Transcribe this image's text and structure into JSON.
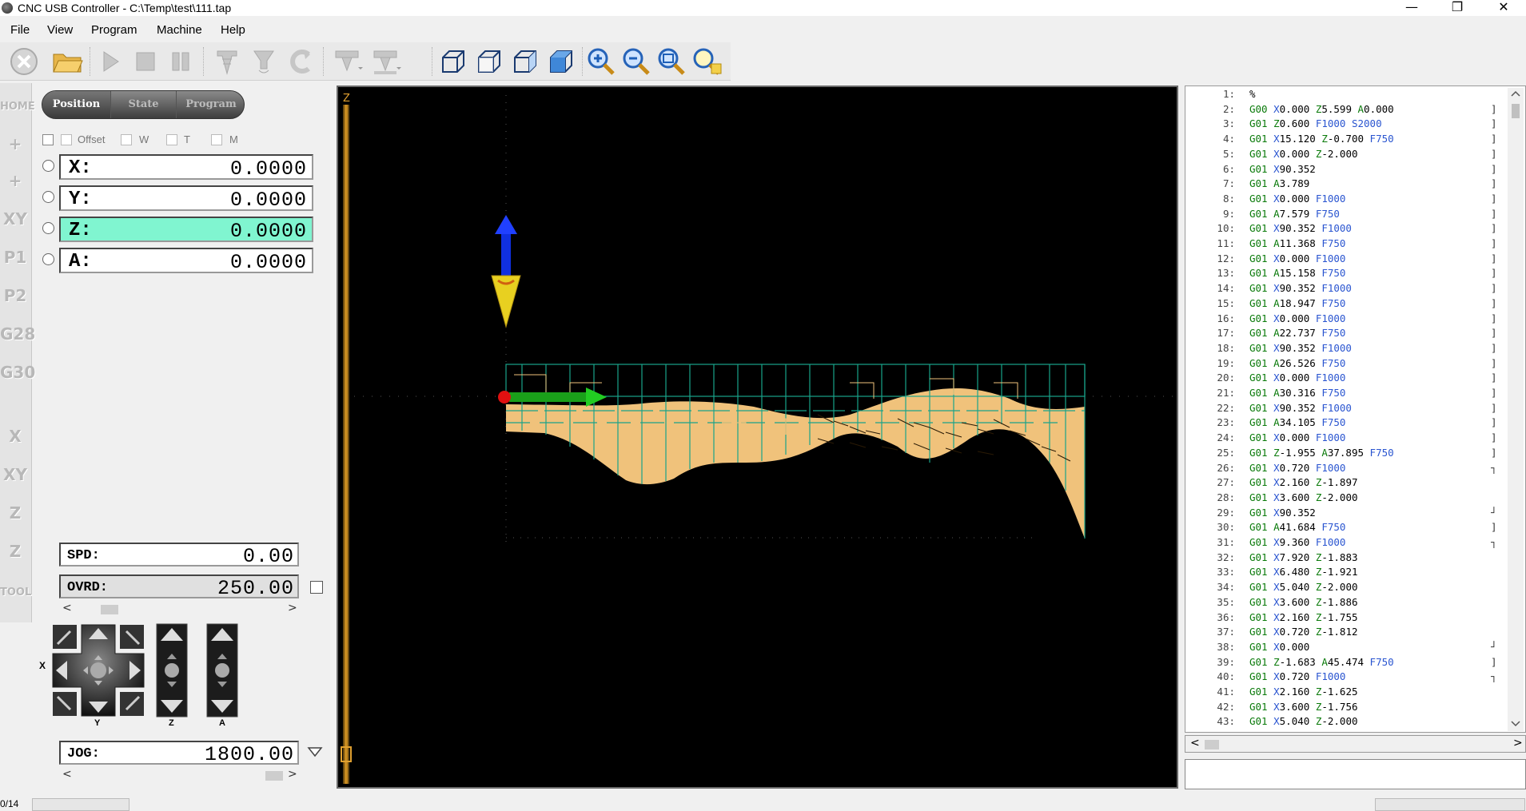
{
  "window": {
    "title": "CNC USB Controller - C:\\Temp\\test\\111.tap",
    "minimize_glyph": "—",
    "restore_glyph": "❐",
    "close_glyph": "✕"
  },
  "menu": [
    "File",
    "View",
    "Program",
    "Machine",
    "Help"
  ],
  "vtoolbar": [
    "HOME",
    "+",
    "+",
    "XY",
    "P1",
    "P2",
    "G28",
    "G30",
    "X",
    "XY",
    "Z",
    "Z",
    "TOOL"
  ],
  "panel": {
    "tabs": [
      "Position",
      "State",
      "Program"
    ],
    "checkbox_labels": [
      "Offset",
      "W",
      "T",
      "M"
    ],
    "axes": [
      {
        "label": "X:",
        "value": "0.0000"
      },
      {
        "label": "Y:",
        "value": "0.0000"
      },
      {
        "label": "Z:",
        "value": "0.0000"
      },
      {
        "label": "A:",
        "value": "0.0000"
      }
    ],
    "spd": {
      "label": "SPD:",
      "value": "0.00"
    },
    "ovrd": {
      "label": "OVRD:",
      "value": "250.00"
    },
    "jog": {
      "label": "JOG:",
      "value": "1800.00"
    },
    "jog_axis_labels": {
      "x": "X",
      "y": "Y",
      "z": "Z",
      "a": "A"
    },
    "scroll_left": "<",
    "scroll_right": ">"
  },
  "viewport": {
    "axis_label": "Z"
  },
  "code_lines": [
    {
      "n": "1:",
      "tokens": [
        [
          "%",
          "p"
        ]
      ],
      "br": ""
    },
    {
      "n": "2:",
      "tokens": [
        [
          "G00",
          "g"
        ],
        [
          "X",
          "x"
        ],
        [
          "0.000",
          "p"
        ],
        [
          "Z",
          "z"
        ],
        [
          "5.599",
          "p"
        ],
        [
          "A",
          "a"
        ],
        [
          "0.000",
          "p"
        ]
      ],
      "br": "]"
    },
    {
      "n": "3:",
      "tokens": [
        [
          "G01",
          "g"
        ],
        [
          "Z",
          "z"
        ],
        [
          "0.600",
          "p"
        ],
        [
          "F1000",
          "f"
        ],
        [
          "S2000",
          "s"
        ]
      ],
      "br": "]"
    },
    {
      "n": "4:",
      "tokens": [
        [
          "G01",
          "g"
        ],
        [
          "X",
          "x"
        ],
        [
          "15.120",
          "p"
        ],
        [
          "Z",
          "z"
        ],
        [
          "-0.700",
          "p"
        ],
        [
          "F750",
          "f"
        ]
      ],
      "br": "]"
    },
    {
      "n": "5:",
      "tokens": [
        [
          "G01",
          "g"
        ],
        [
          "X",
          "x"
        ],
        [
          "0.000",
          "p"
        ],
        [
          "Z",
          "z"
        ],
        [
          "-2.000",
          "p"
        ]
      ],
      "br": "]"
    },
    {
      "n": "6:",
      "tokens": [
        [
          "G01",
          "g"
        ],
        [
          "X",
          "x"
        ],
        [
          "90.352",
          "p"
        ]
      ],
      "br": "]"
    },
    {
      "n": "7:",
      "tokens": [
        [
          "G01",
          "g"
        ],
        [
          "A",
          "a"
        ],
        [
          "3.789",
          "p"
        ]
      ],
      "br": "]"
    },
    {
      "n": "8:",
      "tokens": [
        [
          "G01",
          "g"
        ],
        [
          "X",
          "x"
        ],
        [
          "0.000",
          "p"
        ],
        [
          "F1000",
          "f"
        ]
      ],
      "br": "]"
    },
    {
      "n": "9:",
      "tokens": [
        [
          "G01",
          "g"
        ],
        [
          "A",
          "a"
        ],
        [
          "7.579",
          "p"
        ],
        [
          "F750",
          "f"
        ]
      ],
      "br": "]"
    },
    {
      "n": "10:",
      "tokens": [
        [
          "G01",
          "g"
        ],
        [
          "X",
          "x"
        ],
        [
          "90.352",
          "p"
        ],
        [
          "F1000",
          "f"
        ]
      ],
      "br": "]"
    },
    {
      "n": "11:",
      "tokens": [
        [
          "G01",
          "g"
        ],
        [
          "A",
          "a"
        ],
        [
          "11.368",
          "p"
        ],
        [
          "F750",
          "f"
        ]
      ],
      "br": "]"
    },
    {
      "n": "12:",
      "tokens": [
        [
          "G01",
          "g"
        ],
        [
          "X",
          "x"
        ],
        [
          "0.000",
          "p"
        ],
        [
          "F1000",
          "f"
        ]
      ],
      "br": "]"
    },
    {
      "n": "13:",
      "tokens": [
        [
          "G01",
          "g"
        ],
        [
          "A",
          "a"
        ],
        [
          "15.158",
          "p"
        ],
        [
          "F750",
          "f"
        ]
      ],
      "br": "]"
    },
    {
      "n": "14:",
      "tokens": [
        [
          "G01",
          "g"
        ],
        [
          "X",
          "x"
        ],
        [
          "90.352",
          "p"
        ],
        [
          "F1000",
          "f"
        ]
      ],
      "br": "]"
    },
    {
      "n": "15:",
      "tokens": [
        [
          "G01",
          "g"
        ],
        [
          "A",
          "a"
        ],
        [
          "18.947",
          "p"
        ],
        [
          "F750",
          "f"
        ]
      ],
      "br": "]"
    },
    {
      "n": "16:",
      "tokens": [
        [
          "G01",
          "g"
        ],
        [
          "X",
          "x"
        ],
        [
          "0.000",
          "p"
        ],
        [
          "F1000",
          "f"
        ]
      ],
      "br": "]"
    },
    {
      "n": "17:",
      "tokens": [
        [
          "G01",
          "g"
        ],
        [
          "A",
          "a"
        ],
        [
          "22.737",
          "p"
        ],
        [
          "F750",
          "f"
        ]
      ],
      "br": "]"
    },
    {
      "n": "18:",
      "tokens": [
        [
          "G01",
          "g"
        ],
        [
          "X",
          "x"
        ],
        [
          "90.352",
          "p"
        ],
        [
          "F1000",
          "f"
        ]
      ],
      "br": "]"
    },
    {
      "n": "19:",
      "tokens": [
        [
          "G01",
          "g"
        ],
        [
          "A",
          "a"
        ],
        [
          "26.526",
          "p"
        ],
        [
          "F750",
          "f"
        ]
      ],
      "br": "]"
    },
    {
      "n": "20:",
      "tokens": [
        [
          "G01",
          "g"
        ],
        [
          "X",
          "x"
        ],
        [
          "0.000",
          "p"
        ],
        [
          "F1000",
          "f"
        ]
      ],
      "br": "]"
    },
    {
      "n": "21:",
      "tokens": [
        [
          "G01",
          "g"
        ],
        [
          "A",
          "a"
        ],
        [
          "30.316",
          "p"
        ],
        [
          "F750",
          "f"
        ]
      ],
      "br": "]"
    },
    {
      "n": "22:",
      "tokens": [
        [
          "G01",
          "g"
        ],
        [
          "X",
          "x"
        ],
        [
          "90.352",
          "p"
        ],
        [
          "F1000",
          "f"
        ]
      ],
      "br": "]"
    },
    {
      "n": "23:",
      "tokens": [
        [
          "G01",
          "g"
        ],
        [
          "A",
          "a"
        ],
        [
          "34.105",
          "p"
        ],
        [
          "F750",
          "f"
        ]
      ],
      "br": "]"
    },
    {
      "n": "24:",
      "tokens": [
        [
          "G01",
          "g"
        ],
        [
          "X",
          "x"
        ],
        [
          "0.000",
          "p"
        ],
        [
          "F1000",
          "f"
        ]
      ],
      "br": "]"
    },
    {
      "n": "25:",
      "tokens": [
        [
          "G01",
          "g"
        ],
        [
          "Z",
          "z"
        ],
        [
          "-1.955",
          "p"
        ],
        [
          "A",
          "a"
        ],
        [
          "37.895",
          "p"
        ],
        [
          "F750",
          "f"
        ]
      ],
      "br": "]"
    },
    {
      "n": "26:",
      "tokens": [
        [
          "G01",
          "g"
        ],
        [
          "X",
          "x"
        ],
        [
          "0.720",
          "p"
        ],
        [
          "F1000",
          "f"
        ]
      ],
      "br": "┐"
    },
    {
      "n": "27:",
      "tokens": [
        [
          "G01",
          "g"
        ],
        [
          "X",
          "x"
        ],
        [
          "2.160",
          "p"
        ],
        [
          "Z",
          "z"
        ],
        [
          "-1.897",
          "p"
        ]
      ],
      "br": ""
    },
    {
      "n": "28:",
      "tokens": [
        [
          "G01",
          "g"
        ],
        [
          "X",
          "x"
        ],
        [
          "3.600",
          "p"
        ],
        [
          "Z",
          "z"
        ],
        [
          "-2.000",
          "p"
        ]
      ],
      "br": ""
    },
    {
      "n": "29:",
      "tokens": [
        [
          "G01",
          "g"
        ],
        [
          "X",
          "x"
        ],
        [
          "90.352",
          "p"
        ]
      ],
      "br": "┘"
    },
    {
      "n": "30:",
      "tokens": [
        [
          "G01",
          "g"
        ],
        [
          "A",
          "a"
        ],
        [
          "41.684",
          "p"
        ],
        [
          "F750",
          "f"
        ]
      ],
      "br": "]"
    },
    {
      "n": "31:",
      "tokens": [
        [
          "G01",
          "g"
        ],
        [
          "X",
          "x"
        ],
        [
          "9.360",
          "p"
        ],
        [
          "F1000",
          "f"
        ]
      ],
      "br": "┐"
    },
    {
      "n": "32:",
      "tokens": [
        [
          "G01",
          "g"
        ],
        [
          "X",
          "x"
        ],
        [
          "7.920",
          "p"
        ],
        [
          "Z",
          "z"
        ],
        [
          "-1.883",
          "p"
        ]
      ],
      "br": ""
    },
    {
      "n": "33:",
      "tokens": [
        [
          "G01",
          "g"
        ],
        [
          "X",
          "x"
        ],
        [
          "6.480",
          "p"
        ],
        [
          "Z",
          "z"
        ],
        [
          "-1.921",
          "p"
        ]
      ],
      "br": ""
    },
    {
      "n": "34:",
      "tokens": [
        [
          "G01",
          "g"
        ],
        [
          "X",
          "x"
        ],
        [
          "5.040",
          "p"
        ],
        [
          "Z",
          "z"
        ],
        [
          "-2.000",
          "p"
        ]
      ],
      "br": ""
    },
    {
      "n": "35:",
      "tokens": [
        [
          "G01",
          "g"
        ],
        [
          "X",
          "x"
        ],
        [
          "3.600",
          "p"
        ],
        [
          "Z",
          "z"
        ],
        [
          "-1.886",
          "p"
        ]
      ],
      "br": ""
    },
    {
      "n": "36:",
      "tokens": [
        [
          "G01",
          "g"
        ],
        [
          "X",
          "x"
        ],
        [
          "2.160",
          "p"
        ],
        [
          "Z",
          "z"
        ],
        [
          "-1.755",
          "p"
        ]
      ],
      "br": ""
    },
    {
      "n": "37:",
      "tokens": [
        [
          "G01",
          "g"
        ],
        [
          "X",
          "x"
        ],
        [
          "0.720",
          "p"
        ],
        [
          "Z",
          "z"
        ],
        [
          "-1.812",
          "p"
        ]
      ],
      "br": ""
    },
    {
      "n": "38:",
      "tokens": [
        [
          "G01",
          "g"
        ],
        [
          "X",
          "x"
        ],
        [
          "0.000",
          "p"
        ]
      ],
      "br": "┘"
    },
    {
      "n": "39:",
      "tokens": [
        [
          "G01",
          "g"
        ],
        [
          "Z",
          "z"
        ],
        [
          "-1.683",
          "p"
        ],
        [
          "A",
          "a"
        ],
        [
          "45.474",
          "p"
        ],
        [
          "F750",
          "f"
        ]
      ],
      "br": "]"
    },
    {
      "n": "40:",
      "tokens": [
        [
          "G01",
          "g"
        ],
        [
          "X",
          "x"
        ],
        [
          "0.720",
          "p"
        ],
        [
          "F1000",
          "f"
        ]
      ],
      "br": "┐"
    },
    {
      "n": "41:",
      "tokens": [
        [
          "G01",
          "g"
        ],
        [
          "X",
          "x"
        ],
        [
          "2.160",
          "p"
        ],
        [
          "Z",
          "z"
        ],
        [
          "-1.625",
          "p"
        ]
      ],
      "br": ""
    },
    {
      "n": "42:",
      "tokens": [
        [
          "G01",
          "g"
        ],
        [
          "X",
          "x"
        ],
        [
          "3.600",
          "p"
        ],
        [
          "Z",
          "z"
        ],
        [
          "-1.756",
          "p"
        ]
      ],
      "br": ""
    },
    {
      "n": "43:",
      "tokens": [
        [
          "G01",
          "g"
        ],
        [
          "X",
          "x"
        ],
        [
          "5.040",
          "p"
        ],
        [
          "Z",
          "z"
        ],
        [
          "-2.000",
          "p"
        ]
      ],
      "br": ""
    }
  ],
  "status": {
    "counter": "0/14"
  },
  "colors": {
    "accent_active_axis": "#80f5d0",
    "gcode_green": "#0a7a0a",
    "gcode_blue": "#2a55d0",
    "toolpath_fill": "#f0c27b",
    "toolpath_lines": "#19a38a"
  }
}
